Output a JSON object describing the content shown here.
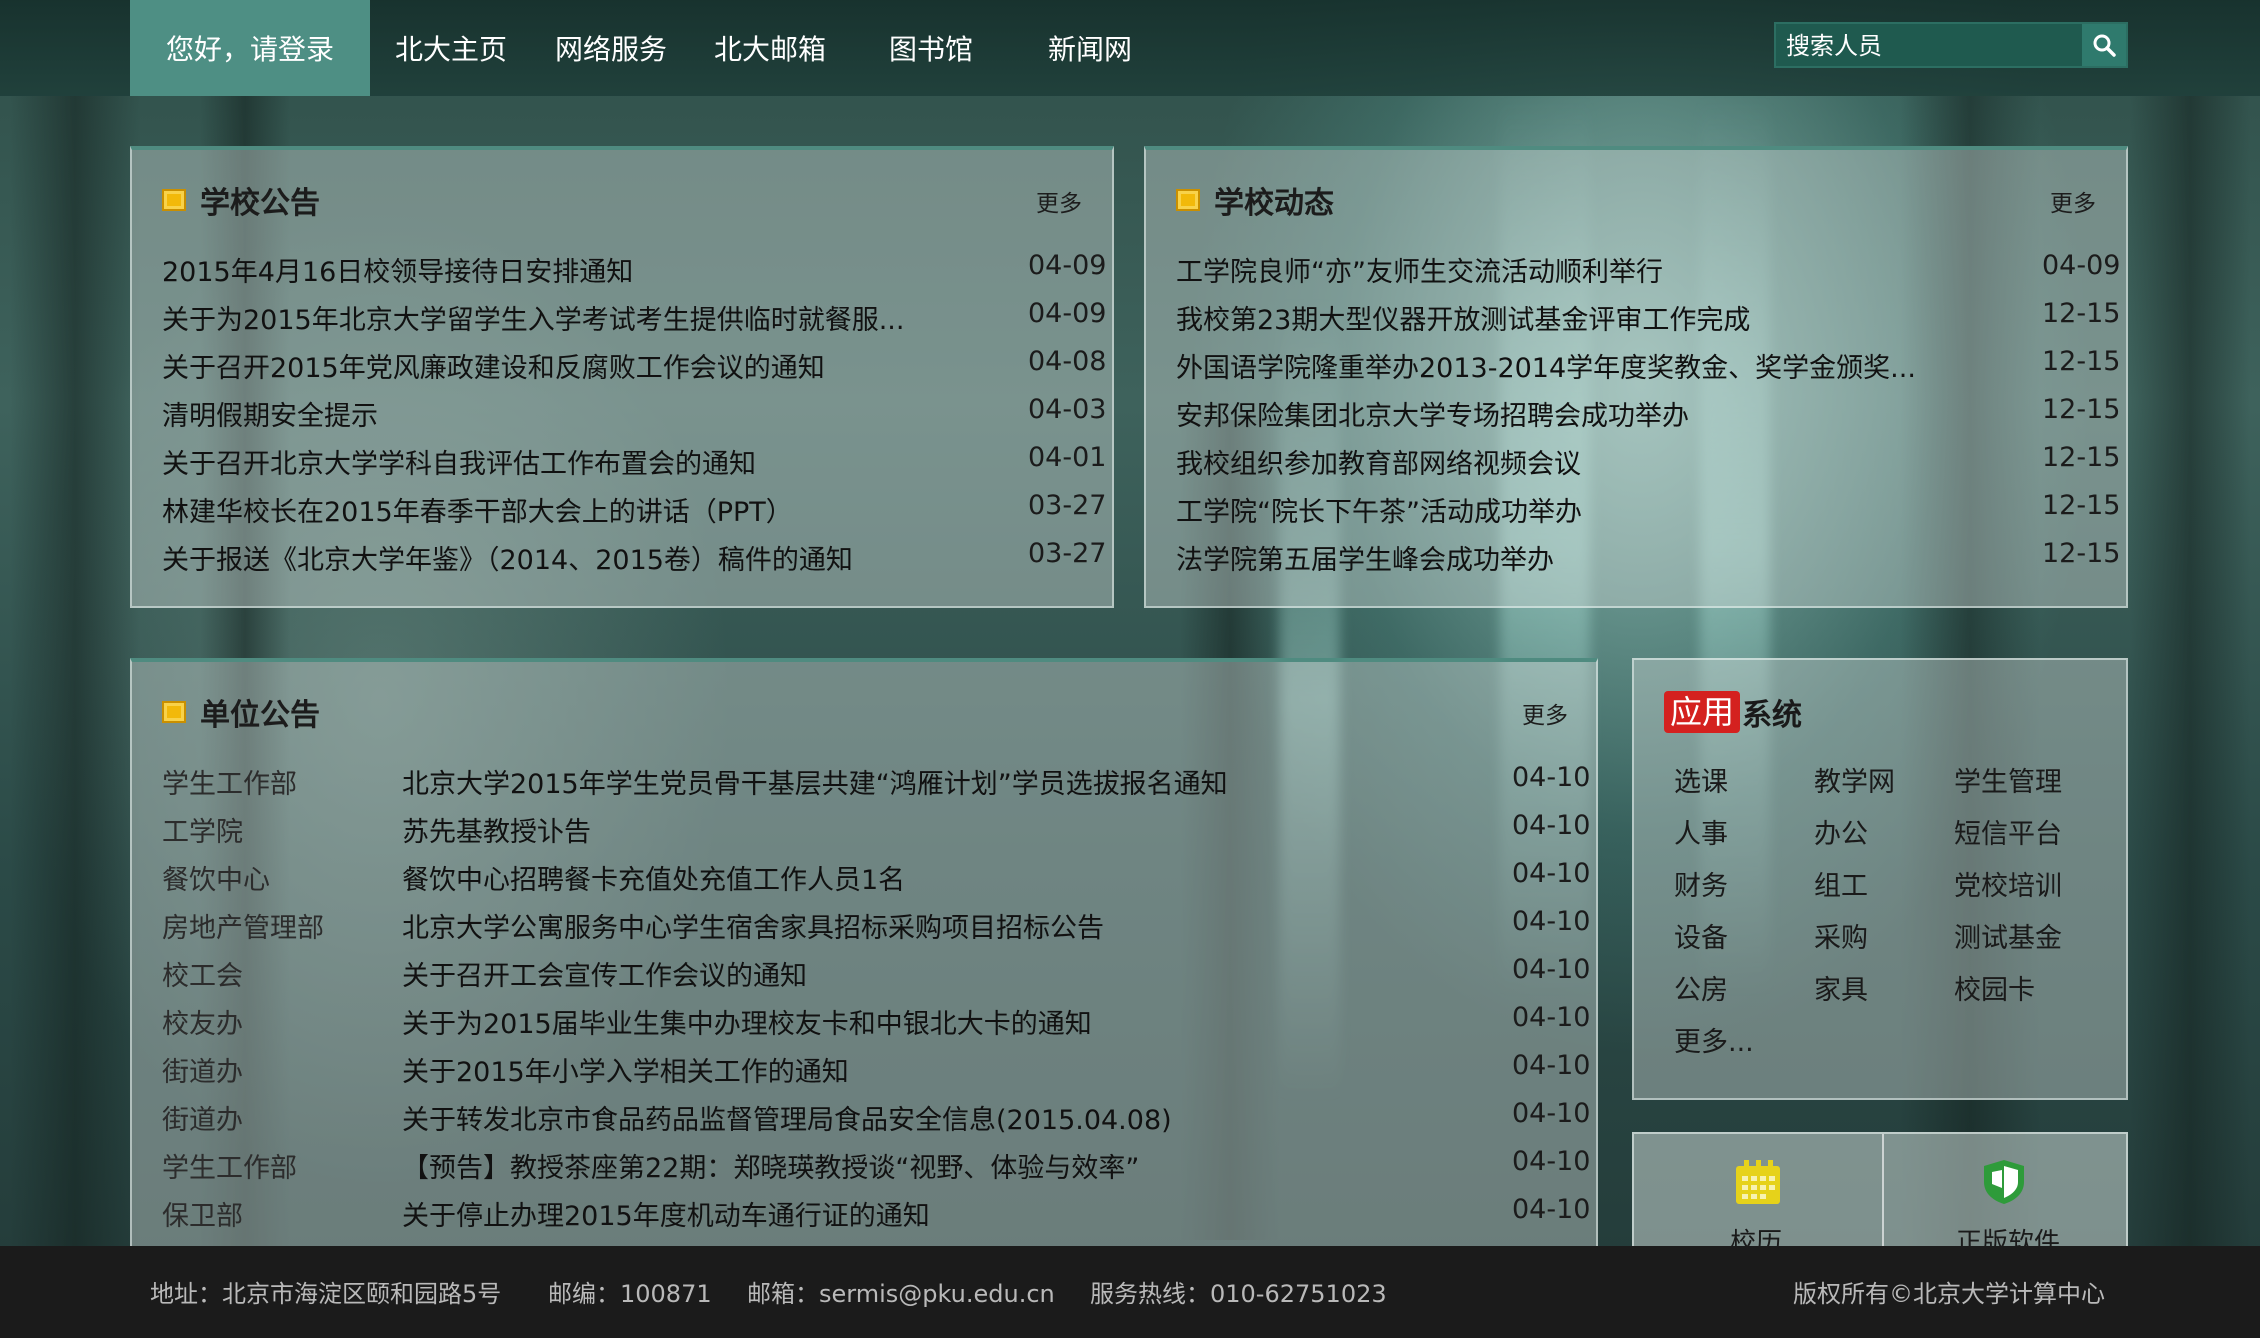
{
  "nav": {
    "login": "您好，请登录",
    "links": [
      "北大主页",
      "网络服务",
      "北大邮箱",
      "图书馆",
      "新闻网"
    ],
    "search_placeholder": "搜索人员",
    "search_icon": "search-icon"
  },
  "school_notice": {
    "title": "学校公告",
    "more": "更多",
    "items": [
      {
        "title": "2015年4月16日校领导接待日安排通知",
        "date": "04-09"
      },
      {
        "title": "关于为2015年北京大学留学生入学考试考生提供临时就餐服...",
        "date": "04-09"
      },
      {
        "title": "关于召开2015年党风廉政建设和反腐败工作会议的通知",
        "date": "04-08"
      },
      {
        "title": "清明假期安全提示",
        "date": "04-03"
      },
      {
        "title": "关于召开北京大学学科自我评估工作布置会的通知",
        "date": "04-01"
      },
      {
        "title": "林建华校长在2015年春季干部大会上的讲话（PPT）",
        "date": "03-27"
      },
      {
        "title": "关于报送《北京大学年鉴》（2014、2015卷）稿件的通知",
        "date": "03-27"
      }
    ]
  },
  "school_news": {
    "title": "学校动态",
    "more": "更多",
    "items": [
      {
        "title": "工学院良师“亦”友师生交流活动顺利举行",
        "date": "04-09"
      },
      {
        "title": "我校第23期大型仪器开放测试基金评审工作完成",
        "date": "12-15"
      },
      {
        "title": "外国语学院隆重举办2013-2014学年度奖教金、奖学金颁奖...",
        "date": "12-15"
      },
      {
        "title": "安邦保险集团北京大学专场招聘会成功举办",
        "date": "12-15"
      },
      {
        "title": "我校组织参加教育部网络视频会议",
        "date": "12-15"
      },
      {
        "title": "工学院“院长下午茶”活动成功举办",
        "date": "12-15"
      },
      {
        "title": "法学院第五届学生峰会成功举办",
        "date": "12-15"
      }
    ]
  },
  "unit_notice": {
    "title": "单位公告",
    "more": "更多",
    "items": [
      {
        "unit": "学生工作部",
        "title": "北京大学2015年学生党员骨干基层共建“鸿雁计划”学员选拔报名通知",
        "date": "04-10"
      },
      {
        "unit": "工学院",
        "title": "苏先基教授讣告",
        "date": "04-10"
      },
      {
        "unit": "餐饮中心",
        "title": "餐饮中心招聘餐卡充值处充值工作人员1名",
        "date": "04-10"
      },
      {
        "unit": "房地产管理部",
        "title": "北京大学公寓服务中心学生宿舍家具招标采购项目招标公告",
        "date": "04-10"
      },
      {
        "unit": "校工会",
        "title": "关于召开工会宣传工作会议的通知",
        "date": "04-10"
      },
      {
        "unit": "校友办",
        "title": "关于为2015届毕业生集中办理校友卡和中银北大卡的通知",
        "date": "04-10"
      },
      {
        "unit": "街道办",
        "title": "关于2015年小学入学相关工作的通知",
        "date": "04-10"
      },
      {
        "unit": "街道办",
        "title": "关于转发北京市食品药品监督管理局食品安全信息(2015.04.08)",
        "date": "04-10"
      },
      {
        "unit": "学生工作部",
        "title": "【预告】教授茶座第22期：郑晓瑛教授谈“视野、体验与效率”",
        "date": "04-10"
      },
      {
        "unit": "保卫部",
        "title": "关于停止办理2015年度机动车通行证的通知",
        "date": "04-10"
      }
    ]
  },
  "app_system": {
    "title_red": "应用",
    "title_rest": "系统",
    "items": [
      "选课",
      "教学网",
      "学生管理",
      "人事",
      "办公",
      "短信平台",
      "财务",
      "组工",
      "党校培训",
      "设备",
      "采购",
      "测试基金",
      "公房",
      "家具",
      "校园卡"
    ],
    "more": "更多..."
  },
  "quick_links": [
    {
      "label": "校历",
      "icon": "calendar-icon",
      "color": "#e6d21a"
    },
    {
      "label": "正版软件",
      "icon": "shield-icon",
      "color": "#2e9b3a"
    }
  ],
  "footer": {
    "address": "地址：北京市海淀区颐和园路5号",
    "postcode": "邮编：100871",
    "email": "邮箱：sermis@pku.edu.cn",
    "hotline": "服务热线：010-62751023",
    "copyright": "版权所有©北京大学计算中心"
  }
}
